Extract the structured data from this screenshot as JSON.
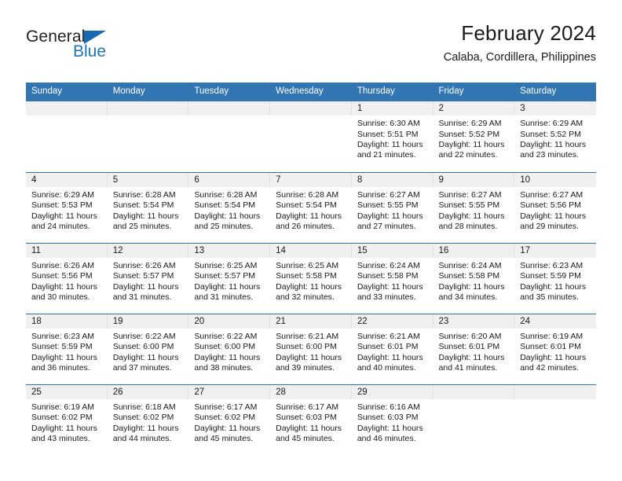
{
  "brand": {
    "name_part1": "General",
    "name_part2": "Blue",
    "triangle_color": "#156bb1",
    "blue_color": "#1b75bb"
  },
  "header": {
    "title": "February 2024",
    "location": "Calaba, Cordillera, Philippines"
  },
  "theme": {
    "header_blue": "#3275b3",
    "row_divider_blue": "#2e74b5",
    "daynum_band": "#f0f0f0",
    "text": "#1a1a1a"
  },
  "weekday_headers": [
    "Sunday",
    "Monday",
    "Tuesday",
    "Wednesday",
    "Thursday",
    "Friday",
    "Saturday"
  ],
  "weeks": [
    [
      {
        "day": ""
      },
      {
        "day": ""
      },
      {
        "day": ""
      },
      {
        "day": ""
      },
      {
        "day": "1",
        "sunrise": "Sunrise: 6:30 AM",
        "sunset": "Sunset: 5:51 PM",
        "daylight_line1": "Daylight: 11 hours",
        "daylight_line2": "and 21 minutes."
      },
      {
        "day": "2",
        "sunrise": "Sunrise: 6:29 AM",
        "sunset": "Sunset: 5:52 PM",
        "daylight_line1": "Daylight: 11 hours",
        "daylight_line2": "and 22 minutes."
      },
      {
        "day": "3",
        "sunrise": "Sunrise: 6:29 AM",
        "sunset": "Sunset: 5:52 PM",
        "daylight_line1": "Daylight: 11 hours",
        "daylight_line2": "and 23 minutes."
      }
    ],
    [
      {
        "day": "4",
        "sunrise": "Sunrise: 6:29 AM",
        "sunset": "Sunset: 5:53 PM",
        "daylight_line1": "Daylight: 11 hours",
        "daylight_line2": "and 24 minutes."
      },
      {
        "day": "5",
        "sunrise": "Sunrise: 6:28 AM",
        "sunset": "Sunset: 5:54 PM",
        "daylight_line1": "Daylight: 11 hours",
        "daylight_line2": "and 25 minutes."
      },
      {
        "day": "6",
        "sunrise": "Sunrise: 6:28 AM",
        "sunset": "Sunset: 5:54 PM",
        "daylight_line1": "Daylight: 11 hours",
        "daylight_line2": "and 25 minutes."
      },
      {
        "day": "7",
        "sunrise": "Sunrise: 6:28 AM",
        "sunset": "Sunset: 5:54 PM",
        "daylight_line1": "Daylight: 11 hours",
        "daylight_line2": "and 26 minutes."
      },
      {
        "day": "8",
        "sunrise": "Sunrise: 6:27 AM",
        "sunset": "Sunset: 5:55 PM",
        "daylight_line1": "Daylight: 11 hours",
        "daylight_line2": "and 27 minutes."
      },
      {
        "day": "9",
        "sunrise": "Sunrise: 6:27 AM",
        "sunset": "Sunset: 5:55 PM",
        "daylight_line1": "Daylight: 11 hours",
        "daylight_line2": "and 28 minutes."
      },
      {
        "day": "10",
        "sunrise": "Sunrise: 6:27 AM",
        "sunset": "Sunset: 5:56 PM",
        "daylight_line1": "Daylight: 11 hours",
        "daylight_line2": "and 29 minutes."
      }
    ],
    [
      {
        "day": "11",
        "sunrise": "Sunrise: 6:26 AM",
        "sunset": "Sunset: 5:56 PM",
        "daylight_line1": "Daylight: 11 hours",
        "daylight_line2": "and 30 minutes."
      },
      {
        "day": "12",
        "sunrise": "Sunrise: 6:26 AM",
        "sunset": "Sunset: 5:57 PM",
        "daylight_line1": "Daylight: 11 hours",
        "daylight_line2": "and 31 minutes."
      },
      {
        "day": "13",
        "sunrise": "Sunrise: 6:25 AM",
        "sunset": "Sunset: 5:57 PM",
        "daylight_line1": "Daylight: 11 hours",
        "daylight_line2": "and 31 minutes."
      },
      {
        "day": "14",
        "sunrise": "Sunrise: 6:25 AM",
        "sunset": "Sunset: 5:58 PM",
        "daylight_line1": "Daylight: 11 hours",
        "daylight_line2": "and 32 minutes."
      },
      {
        "day": "15",
        "sunrise": "Sunrise: 6:24 AM",
        "sunset": "Sunset: 5:58 PM",
        "daylight_line1": "Daylight: 11 hours",
        "daylight_line2": "and 33 minutes."
      },
      {
        "day": "16",
        "sunrise": "Sunrise: 6:24 AM",
        "sunset": "Sunset: 5:58 PM",
        "daylight_line1": "Daylight: 11 hours",
        "daylight_line2": "and 34 minutes."
      },
      {
        "day": "17",
        "sunrise": "Sunrise: 6:23 AM",
        "sunset": "Sunset: 5:59 PM",
        "daylight_line1": "Daylight: 11 hours",
        "daylight_line2": "and 35 minutes."
      }
    ],
    [
      {
        "day": "18",
        "sunrise": "Sunrise: 6:23 AM",
        "sunset": "Sunset: 5:59 PM",
        "daylight_line1": "Daylight: 11 hours",
        "daylight_line2": "and 36 minutes."
      },
      {
        "day": "19",
        "sunrise": "Sunrise: 6:22 AM",
        "sunset": "Sunset: 6:00 PM",
        "daylight_line1": "Daylight: 11 hours",
        "daylight_line2": "and 37 minutes."
      },
      {
        "day": "20",
        "sunrise": "Sunrise: 6:22 AM",
        "sunset": "Sunset: 6:00 PM",
        "daylight_line1": "Daylight: 11 hours",
        "daylight_line2": "and 38 minutes."
      },
      {
        "day": "21",
        "sunrise": "Sunrise: 6:21 AM",
        "sunset": "Sunset: 6:00 PM",
        "daylight_line1": "Daylight: 11 hours",
        "daylight_line2": "and 39 minutes."
      },
      {
        "day": "22",
        "sunrise": "Sunrise: 6:21 AM",
        "sunset": "Sunset: 6:01 PM",
        "daylight_line1": "Daylight: 11 hours",
        "daylight_line2": "and 40 minutes."
      },
      {
        "day": "23",
        "sunrise": "Sunrise: 6:20 AM",
        "sunset": "Sunset: 6:01 PM",
        "daylight_line1": "Daylight: 11 hours",
        "daylight_line2": "and 41 minutes."
      },
      {
        "day": "24",
        "sunrise": "Sunrise: 6:19 AM",
        "sunset": "Sunset: 6:01 PM",
        "daylight_line1": "Daylight: 11 hours",
        "daylight_line2": "and 42 minutes."
      }
    ],
    [
      {
        "day": "25",
        "sunrise": "Sunrise: 6:19 AM",
        "sunset": "Sunset: 6:02 PM",
        "daylight_line1": "Daylight: 11 hours",
        "daylight_line2": "and 43 minutes."
      },
      {
        "day": "26",
        "sunrise": "Sunrise: 6:18 AM",
        "sunset": "Sunset: 6:02 PM",
        "daylight_line1": "Daylight: 11 hours",
        "daylight_line2": "and 44 minutes."
      },
      {
        "day": "27",
        "sunrise": "Sunrise: 6:17 AM",
        "sunset": "Sunset: 6:02 PM",
        "daylight_line1": "Daylight: 11 hours",
        "daylight_line2": "and 45 minutes."
      },
      {
        "day": "28",
        "sunrise": "Sunrise: 6:17 AM",
        "sunset": "Sunset: 6:03 PM",
        "daylight_line1": "Daylight: 11 hours",
        "daylight_line2": "and 45 minutes."
      },
      {
        "day": "29",
        "sunrise": "Sunrise: 6:16 AM",
        "sunset": "Sunset: 6:03 PM",
        "daylight_line1": "Daylight: 11 hours",
        "daylight_line2": "and 46 minutes."
      },
      {
        "day": ""
      },
      {
        "day": ""
      }
    ]
  ]
}
